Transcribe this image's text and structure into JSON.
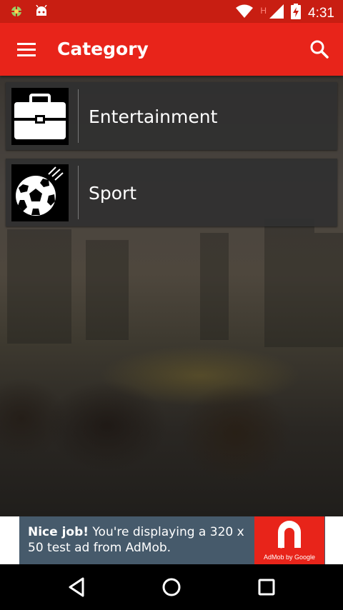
{
  "status_bar": {
    "time": "4:31",
    "network_label": "H",
    "icons": [
      "android-debug-icon",
      "android-icon",
      "wifi-icon",
      "cell-signal-icon",
      "battery-charging-icon"
    ]
  },
  "app_bar": {
    "title": "Category",
    "menu_icon": "hamburger-menu-icon",
    "search_icon": "search-icon",
    "color": "#e8241a"
  },
  "categories": [
    {
      "label": "Entertainment",
      "icon": "briefcase-icon"
    },
    {
      "label": "Sport",
      "icon": "soccer-ball-icon"
    }
  ],
  "ad": {
    "headline": "Nice job!",
    "body": "You're displaying a 320 x 50 test ad from AdMob.",
    "logo_text": "AdMob by Google"
  },
  "nav_bar": {
    "back_icon": "back-icon",
    "home_icon": "home-icon",
    "recents_icon": "recents-icon"
  }
}
